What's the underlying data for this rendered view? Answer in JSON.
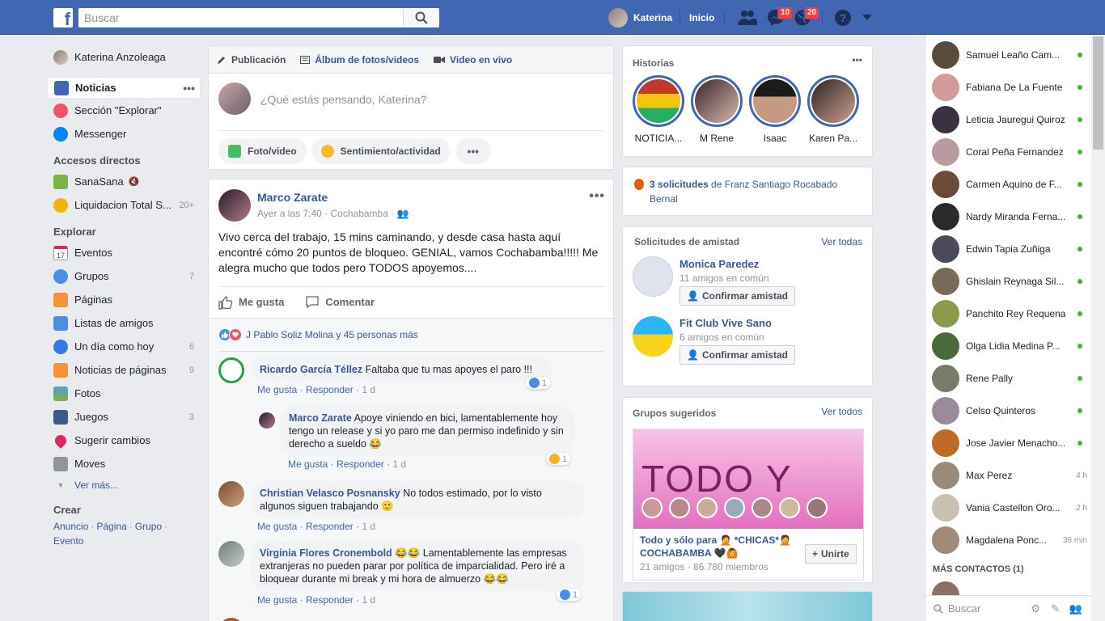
{
  "topbar": {
    "search_placeholder": "Buscar",
    "profile_name": "Katerina",
    "home_label": "Inicio",
    "messages_badge": "10",
    "notifications_badge": "20"
  },
  "leftnav": {
    "profile": "Katerina Anzoleaga",
    "main": [
      {
        "label": "Noticias"
      },
      {
        "label": "Sección \"Explorar\""
      },
      {
        "label": "Messenger"
      }
    ],
    "shortcuts_title": "Accesos directos",
    "shortcuts": [
      {
        "label": "SanaSana",
        "count": ""
      },
      {
        "label": "Liquidacion Total S...",
        "count": "20+"
      }
    ],
    "explore_title": "Explorar",
    "explore": [
      {
        "label": "Eventos",
        "count": ""
      },
      {
        "label": "Grupos",
        "count": "7"
      },
      {
        "label": "Páginas",
        "count": ""
      },
      {
        "label": "Listas de amigos",
        "count": ""
      },
      {
        "label": "Un día como hoy",
        "count": "6"
      },
      {
        "label": "Noticias de páginas",
        "count": "9"
      },
      {
        "label": "Fotos",
        "count": ""
      },
      {
        "label": "Juegos",
        "count": "3"
      },
      {
        "label": "Sugerir cambios",
        "count": ""
      },
      {
        "label": "Moves",
        "count": ""
      }
    ],
    "see_more": "Ver más...",
    "create_title": "Crear",
    "create_links": [
      "Anuncio",
      "Página",
      "Grupo",
      "Evento"
    ],
    "calendar_day": "17"
  },
  "composer": {
    "tabs": [
      "Publicación",
      "Álbum de fotos/videos",
      "Video en vivo"
    ],
    "placeholder": "¿Qué estás pensando, Katerina?",
    "actions": [
      "Foto/video",
      "Sentimiento/actividad"
    ]
  },
  "post": {
    "author": "Marco Zarate",
    "time": "Ayer a las 7:40",
    "location": "Cochabamba",
    "text": "Vivo cerca del trabajo, 15 mins caminando, y desde casa hasta aquí encontré cómo 20 puntos de bloqueo. GENIAL, vamos Cochabamba!!!!! Me alegra mucho que todos pero TODOS apoyemos....",
    "like_label": "Me gusta",
    "comment_label": "Comentar",
    "reactions_text": "J Pablo Soliz Molina y 45 personas más"
  },
  "comments": [
    {
      "name": "Ricardo García Téllez",
      "text": "Faltaba que tu mas apoyes el paro !!!",
      "like": "Me gusta",
      "reply": "Responder",
      "time": "1 d",
      "rx_count": "1"
    },
    {
      "name": "Marco Zarate",
      "text": "Apoye viniendo en bici, lamentablemente hoy tengo un release y si yo paro me dan permiso indefinido y sin derecho a sueldo 😂",
      "like": "Me gusta",
      "reply": "Responder",
      "time": "1 d",
      "rx_count": "1"
    },
    {
      "name": "Christian Velasco Posnansky",
      "text": "No todos estimado, por lo visto algunos siguen trabajando 🙂",
      "like": "Me gusta",
      "reply": "Responder",
      "time": "1 d",
      "rx_count": ""
    },
    {
      "name": "Virginia Flores Cronembold",
      "text": "😂😂 Lamentablemente las empresas extranjeras no pueden parar por política de imparcialidad. Pero iré a bloquear durante mi break y mi hora de almuerzo 😂😂",
      "like": "Me gusta",
      "reply": "Responder",
      "time": "1 d",
      "rx_count": "1"
    }
  ],
  "stories": {
    "title": "Historias",
    "items": [
      "NOTICIA...",
      "M Rene",
      "Isaac",
      "Karen Pa..."
    ]
  },
  "requests_notice": {
    "count_text": "3 solicitudes",
    "rest": " de Franz Santiago Rocabado Bernal"
  },
  "friend_requests": {
    "title": "Solicitudes de amistad",
    "see_all": "Ver todas",
    "items": [
      {
        "name": "Monica Paredez",
        "mutual": "11 amigos en común",
        "button": "Confirmar amistad"
      },
      {
        "name": "Fit Club Vive Sano",
        "mutual": "6 amigos en común",
        "button": "Confirmar amistad"
      }
    ]
  },
  "groups": {
    "title": "Grupos sugeridos",
    "see_all": "Ver todos",
    "banner_text": "TODO Y",
    "group_name": "Todo y sólo para 🤦 *CHICAS*🤦 COCHABAMBA 🖤🙆",
    "meta": "21 amigos · 86.780 miembros",
    "join": "Unirte"
  },
  "chat": {
    "contacts": [
      {
        "name": "Samuel Leaño Cam...",
        "status": "online"
      },
      {
        "name": "Fabiana De La Fuente",
        "status": "online"
      },
      {
        "name": "Leticia Jauregui Quiroz",
        "status": "online"
      },
      {
        "name": "Coral Peña Fernandez",
        "status": "online"
      },
      {
        "name": "Carmen Aquino de F...",
        "status": "online"
      },
      {
        "name": "Nardy Miranda Ferna...",
        "status": "online"
      },
      {
        "name": "Edwin Tapia Zuñiga",
        "status": "online"
      },
      {
        "name": "Ghislain Reynaga Sil...",
        "status": "online"
      },
      {
        "name": "Panchito Rey Requena",
        "status": "online"
      },
      {
        "name": "Olga Lidia Medina P...",
        "status": "online"
      },
      {
        "name": "Rene Pally",
        "status": "online"
      },
      {
        "name": "Celso Quinteros",
        "status": "online"
      },
      {
        "name": "Jose Javier Menacho...",
        "status": "online"
      },
      {
        "name": "Max Perez",
        "status": "4 h"
      },
      {
        "name": "Vania Castellon Oro...",
        "status": "2 h"
      },
      {
        "name": "Magdalena Ponc...",
        "status": "36 min"
      }
    ],
    "more_contacts": "MÁS CONTACTOS (1)",
    "search_placeholder": "Buscar"
  },
  "colors": {
    "brand": "#4267b2",
    "online": "#42b72a",
    "badge": "#fa3e3e"
  }
}
